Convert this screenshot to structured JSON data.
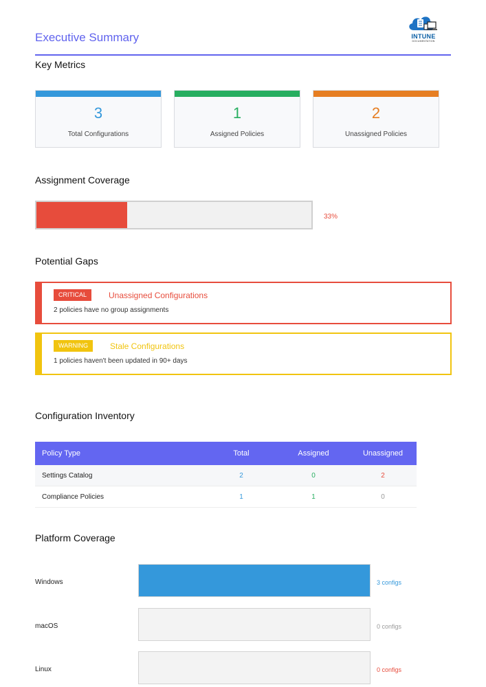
{
  "header": {
    "title": "Executive Summary"
  },
  "logo": {
    "text": "INTUNE",
    "subtext": "DOCUMENTATION"
  },
  "key_metrics": {
    "heading": "Key Metrics",
    "cards": [
      {
        "value": "3",
        "label": "Total Configurations",
        "color": "#3498db"
      },
      {
        "value": "1",
        "label": "Assigned Policies",
        "color": "#27ae60"
      },
      {
        "value": "2",
        "label": "Unassigned Policies",
        "color": "#e67e22"
      }
    ]
  },
  "coverage": {
    "heading": "Assignment Coverage",
    "percent_label": "33%",
    "fraction": 0.33,
    "color": "#e74c3c"
  },
  "gaps": {
    "heading": "Potential Gaps",
    "items": [
      {
        "badge": "CRITICAL",
        "title": "Unassigned Configurations",
        "description": "2 policies have no group assignments",
        "color": "#e74c3c"
      },
      {
        "badge": "WARNING",
        "title": "Stale Configurations",
        "description": "1 policies haven't been updated in 90+ days",
        "color": "#f1c40f"
      }
    ]
  },
  "inventory": {
    "heading": "Configuration Inventory",
    "columns": [
      "Policy Type",
      "Total",
      "Assigned",
      "Unassigned"
    ],
    "rows": [
      {
        "type": "Settings Catalog",
        "total": "2",
        "assigned": "0",
        "unassigned": "2"
      },
      {
        "type": "Compliance Policies",
        "total": "1",
        "assigned": "1",
        "unassigned": "0"
      }
    ],
    "colors": {
      "header": "#6366f1",
      "total": "#3498db",
      "assigned": "#27ae60",
      "unassigned_alert": "#e74c3c",
      "muted": "#999999"
    }
  },
  "platforms": {
    "heading": "Platform Coverage",
    "items": [
      {
        "name": "Windows",
        "count_label": "3 configs",
        "fraction": 1,
        "label_color": "#3498db"
      },
      {
        "name": "macOS",
        "count_label": "0 configs",
        "fraction": 0,
        "label_color": "#999999"
      },
      {
        "name": "Linux",
        "count_label": "0 configs",
        "fraction": 0,
        "label_color": "#e74c3c"
      }
    ]
  }
}
